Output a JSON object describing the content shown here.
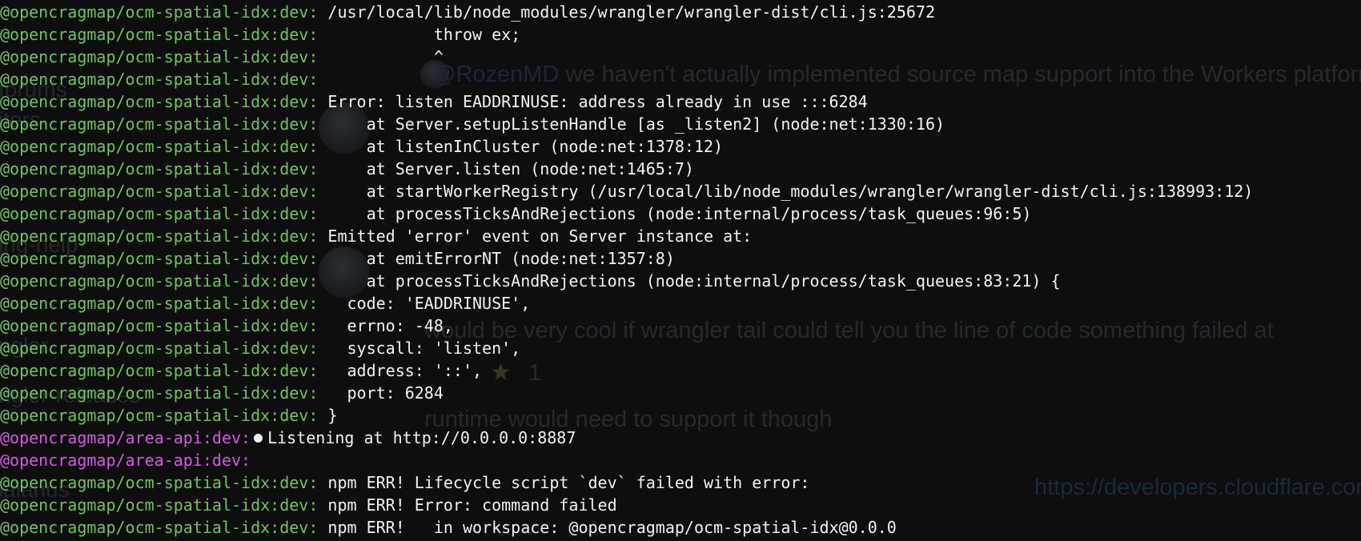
{
  "background_chat": {
    "mention": "@RozenMD",
    "message_1": "we haven't actually implemented source map support into the Workers platform yet, bu",
    "message_2": "would be very cool if wrangler tail could tell you the line of code something failed at",
    "reaction_count": "1",
    "message_3": "runtime would need to support it though",
    "message_4_link": "https://developers.cloudflare.com/"
  },
  "terminal": {
    "lines": [
      {
        "prefix": "@opencragmap/ocm-spatial-idx:dev:",
        "color": "green",
        "text": " /usr/local/lib/node_modules/wrangler/wrangler-dist/cli.js:25672"
      },
      {
        "prefix": "@opencragmap/ocm-spatial-idx:dev:",
        "color": "green",
        "text": "            throw ex;"
      },
      {
        "prefix": "@opencragmap/ocm-spatial-idx:dev:",
        "color": "green",
        "text": "            ^"
      },
      {
        "prefix": "@opencragmap/ocm-spatial-idx:dev:",
        "color": "green",
        "text": ""
      },
      {
        "prefix": "@opencragmap/ocm-spatial-idx:dev:",
        "color": "green",
        "text": " Error: listen EADDRINUSE: address already in use :::6284"
      },
      {
        "prefix": "@opencragmap/ocm-spatial-idx:dev:",
        "color": "green",
        "text": "     at Server.setupListenHandle [as _listen2] (node:net:1330:16)"
      },
      {
        "prefix": "@opencragmap/ocm-spatial-idx:dev:",
        "color": "green",
        "text": "     at listenInCluster (node:net:1378:12)"
      },
      {
        "prefix": "@opencragmap/ocm-spatial-idx:dev:",
        "color": "green",
        "text": "     at Server.listen (node:net:1465:7)"
      },
      {
        "prefix": "@opencragmap/ocm-spatial-idx:dev:",
        "color": "green",
        "text": "     at startWorkerRegistry (/usr/local/lib/node_modules/wrangler/wrangler-dist/cli.js:138993:12)"
      },
      {
        "prefix": "@opencragmap/ocm-spatial-idx:dev:",
        "color": "green",
        "text": "     at processTicksAndRejections (node:internal/process/task_queues:96:5)"
      },
      {
        "prefix": "@opencragmap/ocm-spatial-idx:dev:",
        "color": "green",
        "text": " Emitted 'error' event on Server instance at:"
      },
      {
        "prefix": "@opencragmap/ocm-spatial-idx:dev:",
        "color": "green",
        "text": "     at emitErrorNT (node:net:1357:8)"
      },
      {
        "prefix": "@opencragmap/ocm-spatial-idx:dev:",
        "color": "green",
        "text": "     at processTicksAndRejections (node:internal/process/task_queues:83:21) {"
      },
      {
        "prefix": "@opencragmap/ocm-spatial-idx:dev:",
        "color": "green",
        "text": "   code: 'EADDRINUSE',"
      },
      {
        "prefix": "@opencragmap/ocm-spatial-idx:dev:",
        "color": "green",
        "text": "   errno: -48,"
      },
      {
        "prefix": "@opencragmap/ocm-spatial-idx:dev:",
        "color": "green",
        "text": "   syscall: 'listen',"
      },
      {
        "prefix": "@opencragmap/ocm-spatial-idx:dev:",
        "color": "green",
        "text": "   address: '::',"
      },
      {
        "prefix": "@opencragmap/ocm-spatial-idx:dev:",
        "color": "green",
        "text": "   port: 6284"
      },
      {
        "prefix": "@opencragmap/ocm-spatial-idx:dev:",
        "color": "green",
        "text": " }"
      },
      {
        "prefix": "@opencragmap/area-api:dev:",
        "color": "magenta",
        "text": "Listening at http://0.0.0.0:8887",
        "bullet": true
      },
      {
        "prefix": "@opencragmap/area-api:dev:",
        "color": "magenta",
        "text": ""
      },
      {
        "prefix": "@opencragmap/ocm-spatial-idx:dev:",
        "color": "green",
        "text": " npm ERR! Lifecycle script `dev` failed with error:"
      },
      {
        "prefix": "@opencragmap/ocm-spatial-idx:dev:",
        "color": "green",
        "text": " npm ERR! Error: command failed"
      },
      {
        "prefix": "@opencragmap/ocm-spatial-idx:dev:",
        "color": "green",
        "text": " npm ERR!   in workspace: @opencragmap/ocm-spatial-idx@0.0.0"
      }
    ]
  },
  "colors": {
    "green_prefix": "#73c25f",
    "magenta_prefix": "#d15be0",
    "text": "#f2f2f2",
    "background": "#0e0e0e"
  }
}
